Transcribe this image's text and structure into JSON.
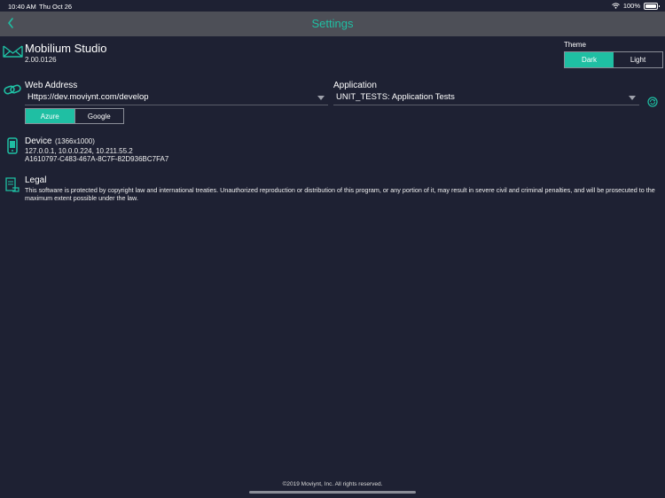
{
  "status_bar": {
    "time": "10:40 AM",
    "date": "Thu Oct 26",
    "battery": "100%"
  },
  "nav": {
    "title": "Settings"
  },
  "app": {
    "name": "Mobilium Studio",
    "version": "2.00.0126"
  },
  "theme": {
    "label": "Theme",
    "options": [
      "Dark",
      "Light"
    ],
    "selected": "Dark"
  },
  "web_address": {
    "label": "Web Address",
    "value": "Https://dev.moviynt.com/develop"
  },
  "application": {
    "label": "Application",
    "value": "UNIT_TESTS: Application Tests"
  },
  "auth_provider": {
    "options": [
      "Azure",
      "Google"
    ],
    "selected": "Azure"
  },
  "device": {
    "label": "Device",
    "resolution": "(1366x1000)",
    "ips": "127.0.0.1, 10.0.0.224, 10.211.55.2",
    "id": "A1610797-C483-467A-8C7F-82D936BC7FA7"
  },
  "legal": {
    "label": "Legal",
    "text": "This software is protected by copyright law and international treaties. Unauthorized reproduction or distribution of this program, or any portion of it, may result in severe civil and criminal penalties, and will be prosecuted to the maximum extent possible under the law."
  },
  "footer": {
    "copyright": "©2019 Moviynt, Inc. All rights reserved."
  },
  "colors": {
    "accent": "#1fbfa3",
    "background": "#1e2133",
    "navbar": "#4d4f57"
  },
  "icons": [
    "wifi-icon",
    "battery-icon",
    "back-chevron-icon",
    "app-logo-icon",
    "link-icon",
    "refresh-icon",
    "device-icon",
    "legal-document-icon"
  ]
}
